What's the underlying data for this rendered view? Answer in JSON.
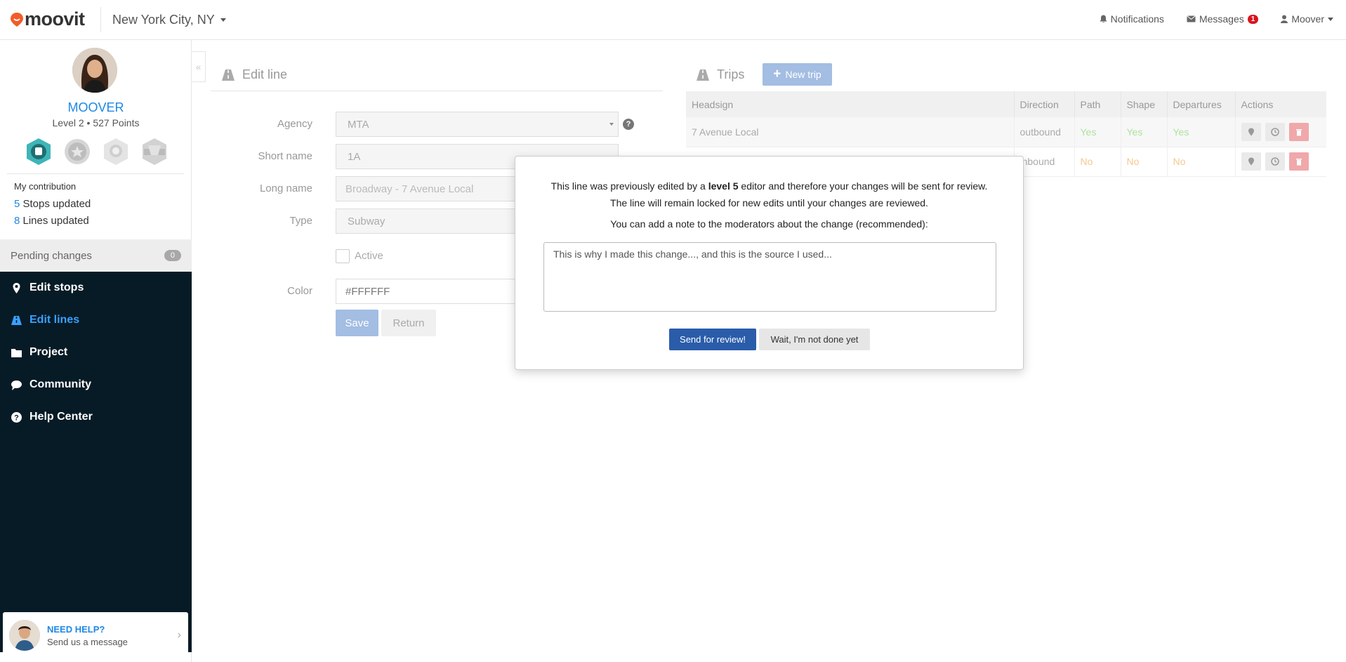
{
  "header": {
    "logo_text": "moovit",
    "city": "New York City, NY",
    "notifications_label": "Notifications",
    "messages_label": "Messages",
    "messages_count": "1",
    "user_label": "Moover"
  },
  "profile": {
    "username": "MOOVER",
    "level_text": "Level 2 • 527 Points",
    "badges": [
      "bus-badge-icon",
      "star-badge-icon",
      "medal-badge-icon",
      "road-badge-icon"
    ],
    "contribution_title": "My contribution",
    "stops_count": "5",
    "stops_label": " Stops updated",
    "lines_count": "8",
    "lines_label": " Lines updated"
  },
  "pending": {
    "label": "Pending changes",
    "count": "0"
  },
  "nav": {
    "items": [
      {
        "label": "Edit stops",
        "icon": "map-pin-icon"
      },
      {
        "label": "Edit lines",
        "icon": "road-icon",
        "active": true
      },
      {
        "label": "Project",
        "icon": "folder-icon"
      },
      {
        "label": "Community",
        "icon": "chat-icon"
      },
      {
        "label": "Help Center",
        "icon": "question-icon"
      }
    ]
  },
  "help_card": {
    "title": "NEED HELP?",
    "subtitle": "Send us a message"
  },
  "edit_line": {
    "title": "Edit line",
    "agency_label": "Agency",
    "agency_value": "MTA",
    "short_name_label": "Short name",
    "short_name_value": "1A",
    "long_name_label": "Long name",
    "long_name_placeholder": "Broadway - 7 Avenue Local",
    "type_label": "Type",
    "type_value": "Subway",
    "active_label": "Active",
    "color_label": "Color",
    "color_value": "#FFFFFF",
    "save_label": "Save",
    "return_label": "Return"
  },
  "trips": {
    "title": "Trips",
    "new_trip_label": "New trip",
    "columns": [
      "Headsign",
      "Direction",
      "Path",
      "Shape",
      "Departures",
      "Actions"
    ],
    "rows": [
      {
        "headsign": "7 Avenue Local",
        "direction": "outbound",
        "path": "Yes",
        "shape": "Yes",
        "departures": "Yes"
      },
      {
        "headsign": "",
        "direction": "inbound",
        "path": "No",
        "shape": "No",
        "departures": "No"
      }
    ]
  },
  "modal": {
    "text_before": "This line was previously edited by a ",
    "text_bold": "level 5",
    "text_after": " editor and therefore your changes will be sent for review. The line will remain locked for new edits until your changes are reviewed.",
    "note_prompt": "You can add a note to the moderators about the change (recommended):",
    "note_value": "This is why I made this change..., and this is the source I used...",
    "send_label": "Send for review!",
    "wait_label": "Wait, I'm not done yet"
  },
  "colors": {
    "brand_orange": "#f25c29",
    "accent_blue": "#1e88e5",
    "nav_bg": "#071b26",
    "send_button": "#2a5caa"
  }
}
